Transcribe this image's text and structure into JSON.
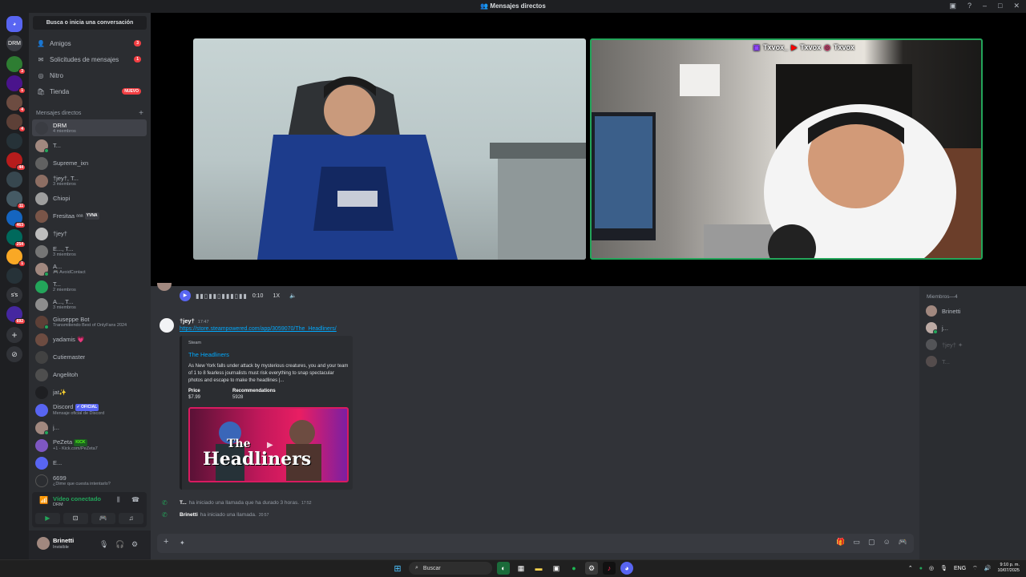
{
  "window": {
    "title": "Mensajes directos"
  },
  "rail": {
    "servers": [
      {
        "label": "",
        "badge": ""
      },
      {
        "label": "DRM",
        "badge": ""
      },
      {
        "label": "",
        "badge": "3"
      },
      {
        "label": "",
        "badge": "1"
      },
      {
        "label": "",
        "badge": "4"
      },
      {
        "label": "",
        "badge": "4"
      },
      {
        "label": "",
        "badge": ""
      },
      {
        "label": "",
        "badge": "44"
      },
      {
        "label": "",
        "badge": ""
      },
      {
        "label": "",
        "badge": "11"
      },
      {
        "label": "",
        "badge": "463"
      },
      {
        "label": "",
        "badge": "254"
      },
      {
        "label": "",
        "badge": "1"
      },
      {
        "label": "",
        "badge": ""
      },
      {
        "label": "s's",
        "badge": ""
      },
      {
        "label": "",
        "badge": "692"
      }
    ]
  },
  "sidebar": {
    "search": "Busca o inicia una conversación",
    "nav": [
      {
        "label": "Amigos",
        "badge": "3"
      },
      {
        "label": "Solicitudes de mensajes",
        "badge": "1"
      },
      {
        "label": "Nitro",
        "badge": ""
      },
      {
        "label": "Tienda",
        "badge": "NUEVO"
      }
    ],
    "dm_header": "Mensajes directos",
    "dms": [
      {
        "name": "DRM",
        "sub": "4 miembros"
      },
      {
        "name": "T...",
        "sub": ""
      },
      {
        "name": "Supreme_ixn",
        "sub": ""
      },
      {
        "name": "†jey†, T...",
        "sub": "3 miembros"
      },
      {
        "name": "Ͼhiopi",
        "sub": ""
      },
      {
        "name": "Fresitaa ᵃᵃᵃ",
        "sub": "",
        "tag": "YVNA"
      },
      {
        "name": "†jey†",
        "sub": ""
      },
      {
        "name": "E..., T...",
        "sub": "3 miembros"
      },
      {
        "name": "A...",
        "sub": "AvoidContact"
      },
      {
        "name": "T...",
        "sub": "2 miembros"
      },
      {
        "name": "A..., T...",
        "sub": "3 miembros"
      },
      {
        "name": "Giuseppe Bot",
        "sub": "Transmitiendo Best of OnlyFans 2024"
      },
      {
        "name": "yadamis 💗",
        "sub": ""
      },
      {
        "name": "Cutiemaster",
        "sub": ""
      },
      {
        "name": "Angelitoh",
        "sub": ""
      },
      {
        "name": "jat✨",
        "sub": ""
      },
      {
        "name": "Discord",
        "sub": "Mensaje oficial de Discord",
        "tag": "OFICIAL"
      },
      {
        "name": "j...",
        "sub": ""
      },
      {
        "name": "PeZeta",
        "sub": "+1 - Kick.com/PeZeta7",
        "tag": "KICK"
      },
      {
        "name": "E...",
        "sub": ""
      },
      {
        "name": "6699",
        "sub": "¿Dime que cuesta intentarlo?"
      }
    ],
    "voice": {
      "status": "Vídeo conectado",
      "channel": "DRM"
    },
    "user": {
      "name": "Brinetti",
      "status": "Invisible"
    }
  },
  "stage": {
    "socials": [
      "Txvox_",
      "Txvox",
      "Txvox"
    ]
  },
  "chat": {
    "audio": {
      "time": "0:10",
      "speed": "1X"
    },
    "message": {
      "author": "†jey†",
      "time": "17:47",
      "link": "https://store.steampowered.com/app/3059070/The_Headliners/",
      "embed": {
        "provider": "Steam",
        "title": "The Headliners",
        "description": "As New York falls under attack by mysterious creatures, you and your team of 1 to 8 fearless journalists must risk everything to snap spectacular photos and escape to make the headlines |...",
        "field1_name": "Price",
        "field1_value": "$7.99",
        "field2_name": "Recommendations",
        "field2_value": "5928",
        "thumb_line1": "The",
        "thumb_line2": "Headliners"
      }
    },
    "calls": [
      {
        "who": "T...",
        "text": "ha iniciado una llamada que ha durado 3 horas.",
        "time": "17:52"
      },
      {
        "who": "Brinetti",
        "text": "ha iniciado una llamada.",
        "time": "20:57"
      }
    ]
  },
  "members": {
    "header": "Miembros—4",
    "list": [
      "Brinetti",
      "j...",
      "†jey† ✦",
      "T..."
    ]
  },
  "taskbar": {
    "search": "Buscar",
    "lang": "ENG",
    "time": "9:10 p. m.",
    "date": "10/07/2025"
  },
  "colors": {
    "accent": "#5865f2",
    "online": "#23a55a",
    "alert": "#f23f43",
    "link": "#00a8fc"
  }
}
